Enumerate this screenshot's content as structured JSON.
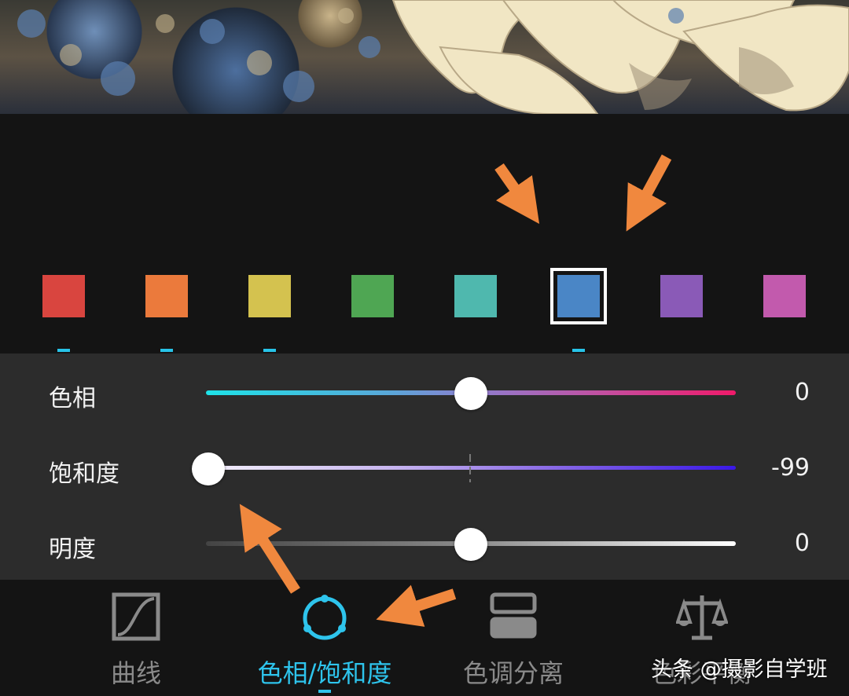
{
  "colors": {
    "accent": "#2ec4ec",
    "annotation_arrow": "#f0883e",
    "panel_bg": "#2c2c2c",
    "app_bg": "#141414"
  },
  "swatches": [
    {
      "name": "red",
      "color": "#d9453f",
      "marked": true,
      "selected": false
    },
    {
      "name": "orange",
      "color": "#eb7a3c",
      "marked": true,
      "selected": false
    },
    {
      "name": "yellow",
      "color": "#d4c24f",
      "marked": true,
      "selected": false
    },
    {
      "name": "green",
      "color": "#4fa653",
      "marked": false,
      "selected": false
    },
    {
      "name": "aqua",
      "color": "#4fb8ae",
      "marked": false,
      "selected": false
    },
    {
      "name": "blue",
      "color": "#4a86c6",
      "marked": true,
      "selected": true
    },
    {
      "name": "purple",
      "color": "#8a5ab7",
      "marked": false,
      "selected": false
    },
    {
      "name": "magenta",
      "color": "#c25aad",
      "marked": false,
      "selected": false
    }
  ],
  "sliders": [
    {
      "label": "色相",
      "value": "0",
      "position": 0.5
    },
    {
      "label": "饱和度",
      "value": "-99",
      "position": 0.005
    },
    {
      "label": "明度",
      "value": "0",
      "position": 0.5
    }
  ],
  "tabs": [
    {
      "label": "曲线",
      "icon": "curve-icon",
      "active": false
    },
    {
      "label": "色相/饱和度",
      "icon": "hue-saturation-icon",
      "active": true
    },
    {
      "label": "色调分离",
      "icon": "split-toning-icon",
      "active": false
    },
    {
      "label": "色彩平衡",
      "icon": "color-balance-icon",
      "active": false
    }
  ],
  "watermark": "头条 @摄影自学班"
}
